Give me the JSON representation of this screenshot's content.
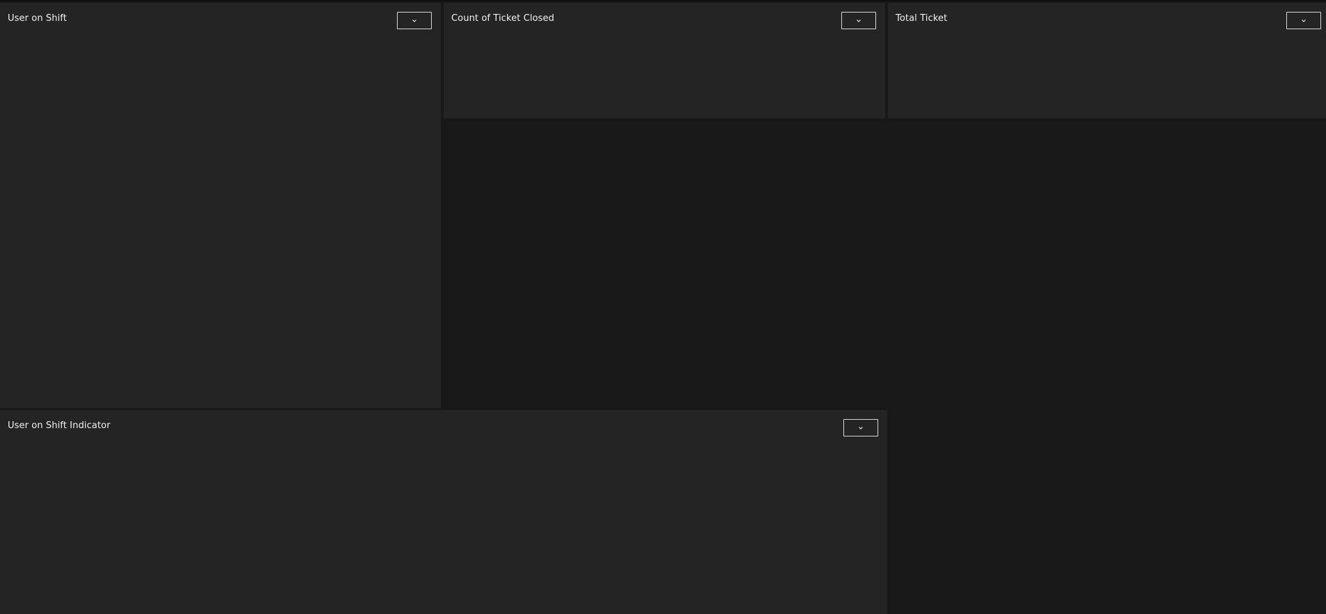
{
  "panels": {
    "user_on_shift": {
      "title": "User on Shift",
      "menu_icon": "chevron-down-icon"
    },
    "count_ticket_closed": {
      "title": "Count of Ticket Closed",
      "menu_icon": "chevron-down-icon"
    },
    "total_ticket": {
      "title": "Total Ticket",
      "menu_icon": "chevron-down-icon"
    },
    "user_on_shift_indicator": {
      "title": "User on Shift Indicator",
      "menu_icon": "chevron-down-icon"
    }
  },
  "colors": {
    "background": "#181818",
    "panel": "#242424",
    "text": "#f2f2f2",
    "button_border": "#d8d8d8"
  }
}
